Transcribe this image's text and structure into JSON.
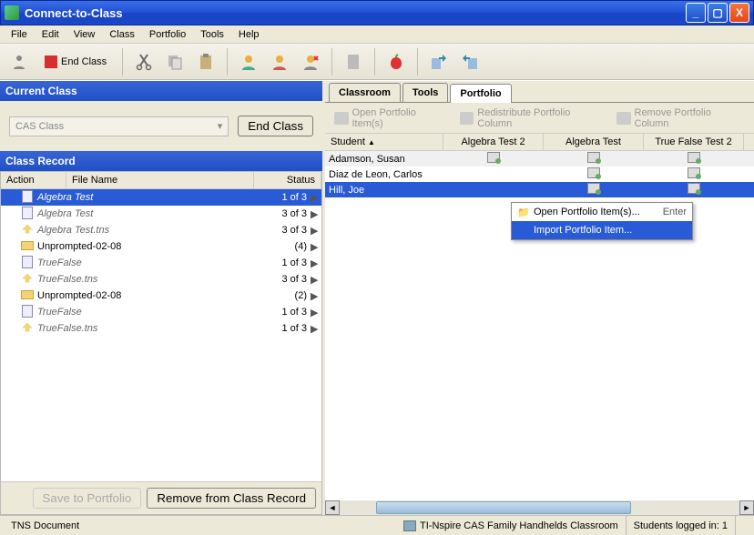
{
  "window": {
    "title": "Connect-to-Class"
  },
  "menu": [
    "File",
    "Edit",
    "View",
    "Class",
    "Portfolio",
    "Tools",
    "Help"
  ],
  "toolbar": {
    "endclass": "End Class"
  },
  "left": {
    "currentClassHdr": "Current Class",
    "casClass": "CAS Class",
    "endClassBtn": "End Class",
    "classRecordHdr": "Class Record",
    "cols": {
      "action": "Action",
      "file": "File Name",
      "status": "Status"
    },
    "rows": [
      {
        "name": "Algebra Test",
        "status": "1 of 3",
        "sel": true,
        "icon": "calc",
        "arrow": true
      },
      {
        "name": "Algebra Test",
        "status": "3 of 3",
        "italic": true,
        "icon": "calc",
        "arrow": true
      },
      {
        "name": "Algebra Test.tns",
        "status": "3 of 3",
        "italic": true,
        "icon": "arrowup",
        "arrow": true
      },
      {
        "name": "Unprompted-02-08",
        "status": "(4)",
        "icon": "folder",
        "arrow": true
      },
      {
        "name": "TrueFalse",
        "status": "1 of 3",
        "italic": true,
        "icon": "calc",
        "arrow": true
      },
      {
        "name": "TrueFalse.tns",
        "status": "3 of 3",
        "italic": true,
        "icon": "arrowup",
        "arrow": true
      },
      {
        "name": "Unprompted-02-08",
        "status": "(2)",
        "icon": "folder",
        "arrow": true
      },
      {
        "name": "TrueFalse",
        "status": "1 of 3",
        "italic": true,
        "icon": "calc",
        "arrow": true
      },
      {
        "name": "TrueFalse.tns",
        "status": "1 of 3",
        "italic": true,
        "icon": "arrowup",
        "arrow": true
      }
    ],
    "saveBtn": "Save to Portfolio",
    "removeBtn": "Remove from Class Record"
  },
  "right": {
    "tabs": [
      "Classroom",
      "Tools",
      "Portfolio"
    ],
    "ptoolbar": {
      "open": "Open Portfolio Item(s)",
      "redist": "Redistribute Portfolio Column",
      "remove": "Remove Portfolio Column"
    },
    "gridcols": {
      "student": "Student",
      "c1": "Algebra Test 2",
      "c2": "Algebra Test",
      "c3": "True False Test 2"
    },
    "gridrows": [
      {
        "student": "Adamson, Susan",
        "c1": true,
        "c2": true,
        "c3": true
      },
      {
        "student": "Diaz de Leon, Carlos",
        "c1": false,
        "c2": true,
        "c3": true
      },
      {
        "student": "Hill, Joe",
        "c1": false,
        "c2": true,
        "c3": true,
        "sel": true
      }
    ],
    "ctx": {
      "open": "Open Portfolio Item(s)...",
      "openAcc": "Enter",
      "import": "Import Portfolio Item..."
    }
  },
  "status": {
    "doc": "TNS Document",
    "classroom": "TI-Nspire CAS Family Handhelds Classroom",
    "logged": "Students logged in:  1"
  }
}
